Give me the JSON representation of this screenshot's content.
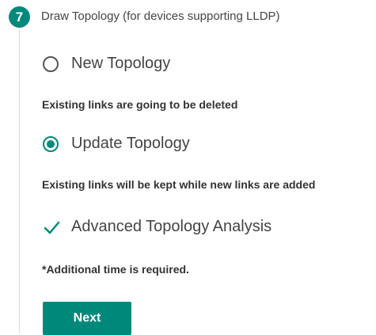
{
  "step": {
    "number": "7",
    "title": "Draw Topology (for devices supporting LLDP)"
  },
  "options": {
    "new_topology": {
      "label": "New Topology",
      "selected": false,
      "description": "Existing links are going to be deleted"
    },
    "update_topology": {
      "label": "Update Topology",
      "selected": true,
      "description": "Existing links will be kept while new links are added"
    }
  },
  "advanced_analysis": {
    "label": "Advanced Topology Analysis",
    "checked": true,
    "note": "*Additional time is required."
  },
  "actions": {
    "next_label": "Next"
  },
  "colors": {
    "accent": "#00897b",
    "text": "#333333"
  }
}
